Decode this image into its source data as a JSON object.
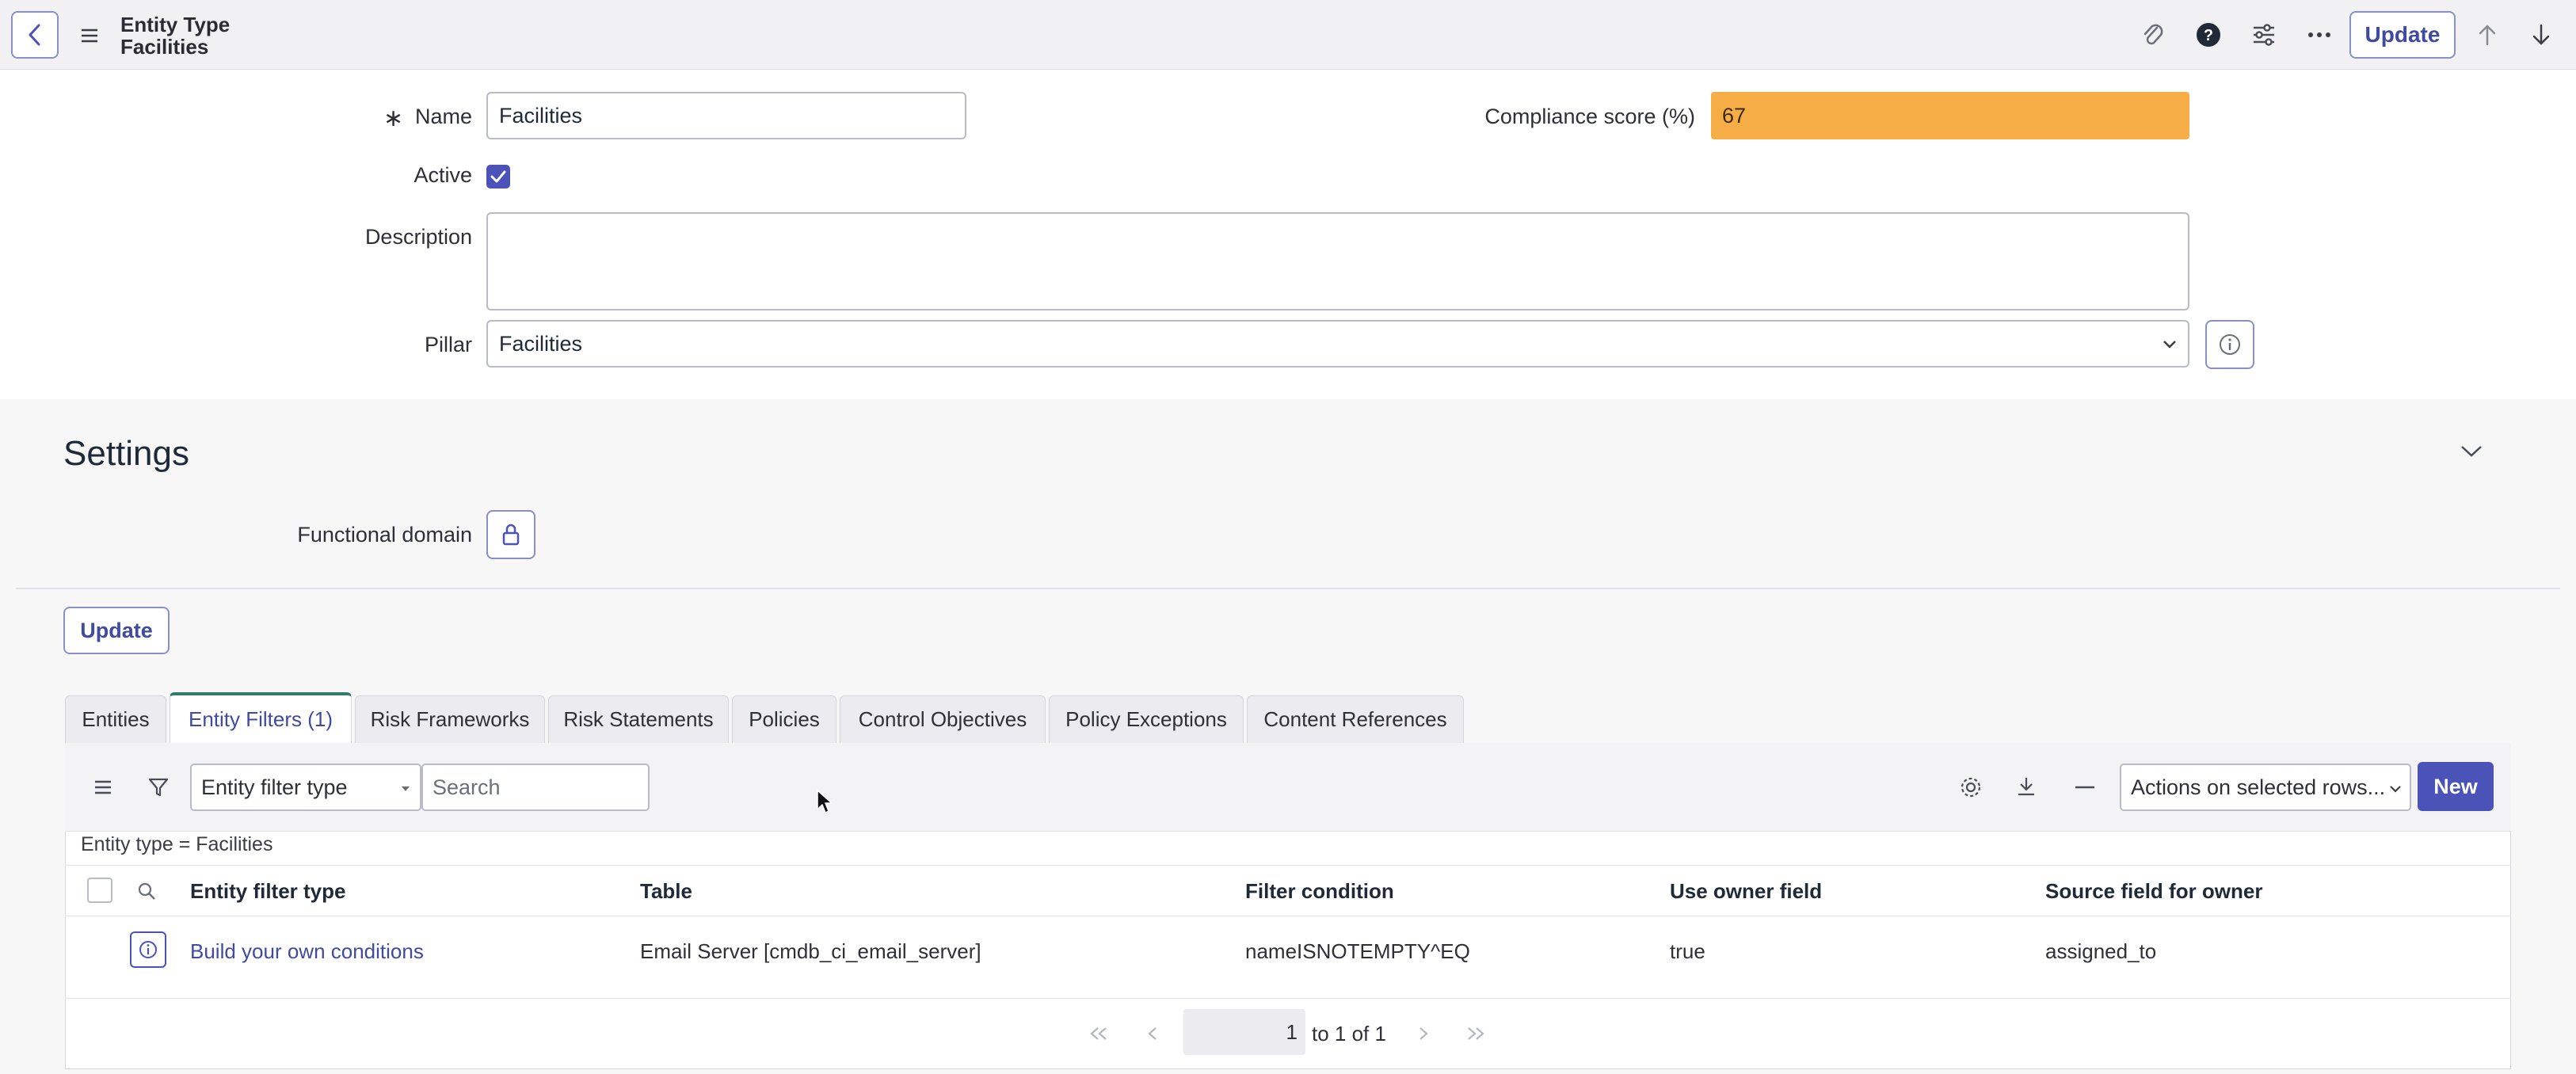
{
  "header": {
    "title_line1": "Entity Type",
    "title_line2": "Facilities",
    "update_label": "Update",
    "icons": [
      "back-icon",
      "menu-icon",
      "paperclip-icon",
      "help-icon",
      "sliders-icon",
      "more-icon",
      "arrow-up-icon",
      "arrow-down-icon"
    ]
  },
  "form": {
    "name_label": "Name",
    "name_required_mark": "∗",
    "name_value": "Facilities",
    "compliance_label": "Compliance score (%)",
    "compliance_value": "67",
    "active_label": "Active",
    "active_checked": true,
    "description_label": "Description",
    "description_value": "",
    "pillar_label": "Pillar",
    "pillar_value": "Facilities"
  },
  "settings": {
    "title": "Settings",
    "functional_domain_label": "Functional domain",
    "update_label": "Update"
  },
  "tabs": [
    {
      "label": "Entities",
      "active": false
    },
    {
      "label": "Entity Filters (1)",
      "active": true
    },
    {
      "label": "Risk Frameworks",
      "active": false
    },
    {
      "label": "Risk Statements",
      "active": false
    },
    {
      "label": "Policies",
      "active": false
    },
    {
      "label": "Control Objectives",
      "active": false
    },
    {
      "label": "Policy Exceptions",
      "active": false
    },
    {
      "label": "Content References",
      "active": false
    }
  ],
  "list": {
    "filter_field": "Entity filter type",
    "search_placeholder": "Search",
    "actions_select": "Actions on selected rows...",
    "new_label": "New",
    "breadcrumb": "Entity type = Facilities",
    "columns": [
      "Entity filter type",
      "Table",
      "Filter condition",
      "Use owner field",
      "Source field for owner"
    ],
    "rows": [
      [
        "Build your own conditions",
        "Email Server [cmdb_ci_email_server]",
        "nameISNOTEMPTY^EQ",
        "true",
        "assigned_to"
      ]
    ],
    "pagination": {
      "current": "1",
      "of_text": "to 1 of 1"
    }
  },
  "colors": {
    "accent": "#4b52b8",
    "compliance_fill": "#f6ad45",
    "active_tab_border": "#2e7d6b"
  }
}
